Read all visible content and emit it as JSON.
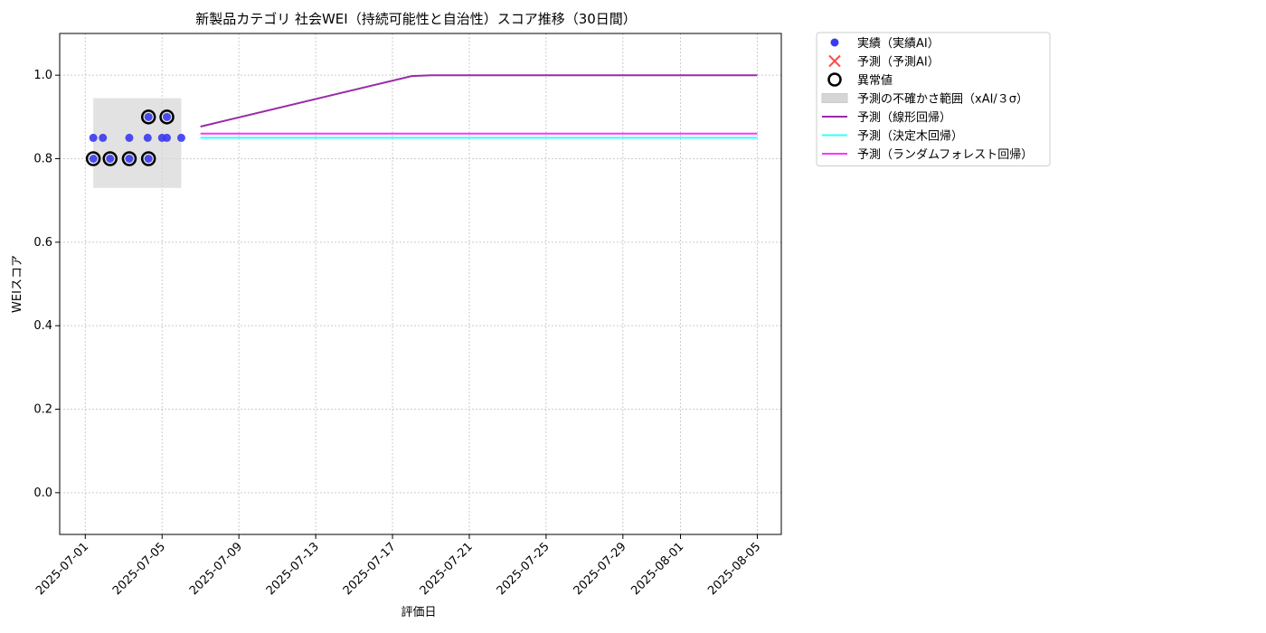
{
  "chart_data": {
    "type": "line",
    "title": "新製品カテゴリ 社会WEI（持続可能性と自治性）スコア推移（30日間）",
    "xlabel": "評価日",
    "ylabel": "WEIスコア",
    "xlim": [
      "2025-06-29T16:00",
      "2025-08-06T06:00"
    ],
    "ylim": [
      -0.1,
      1.1
    ],
    "x_ticks": [
      "2025-07-01",
      "2025-07-05",
      "2025-07-09",
      "2025-07-13",
      "2025-07-17",
      "2025-07-21",
      "2025-07-25",
      "2025-07-29",
      "2025-08-01",
      "2025-08-05"
    ],
    "x_tick_label_rotation": 45,
    "y_ticks": [
      0.0,
      0.2,
      0.4,
      0.6,
      0.8,
      1.0
    ],
    "y_tick_labels": [
      "0.0",
      "0.2",
      "0.4",
      "0.6",
      "0.8",
      "1.0"
    ],
    "grid": true,
    "legend_position": "outside-top-right",
    "legend": [
      {
        "key": "actual",
        "label": "実績（実績AI）",
        "marker": "dot",
        "color": "#3a3af0"
      },
      {
        "key": "forecast_ai",
        "label": "予測（予測AI）",
        "marker": "x",
        "color": "#ff4a4a"
      },
      {
        "key": "anomaly",
        "label": "異常値",
        "marker": "ring",
        "color": "#000000"
      },
      {
        "key": "uncertainty",
        "label": "予測の不確かさ範囲（xAI/３σ）",
        "marker": "box",
        "color": "#d6d6d6"
      },
      {
        "key": "linear",
        "label": "予測（線形回帰）",
        "marker": "line",
        "color": "#9a2aa8"
      },
      {
        "key": "tree",
        "label": "予測（決定木回帰）",
        "marker": "line",
        "color": "#33ffff"
      },
      {
        "key": "forest",
        "label": "予測（ランダムフォレスト回帰）",
        "marker": "line",
        "color": "#ff33ff"
      }
    ],
    "series": [
      {
        "key": "actual",
        "name": "実績（実績AI）",
        "kind": "scatter",
        "color": "#3a3af0",
        "points": [
          {
            "x": "2025-07-01T10:00",
            "y": 0.85
          },
          {
            "x": "2025-07-01T10:00",
            "y": 0.8
          },
          {
            "x": "2025-07-01T22:00",
            "y": 0.85
          },
          {
            "x": "2025-07-02T07:00",
            "y": 0.8
          },
          {
            "x": "2025-07-03T07:00",
            "y": 0.85
          },
          {
            "x": "2025-07-03T07:00",
            "y": 0.8
          },
          {
            "x": "2025-07-04T06:00",
            "y": 0.85
          },
          {
            "x": "2025-07-04T07:00",
            "y": 0.9
          },
          {
            "x": "2025-07-04T07:00",
            "y": 0.8
          },
          {
            "x": "2025-07-05T00:00",
            "y": 0.85
          },
          {
            "x": "2025-07-05T06:00",
            "y": 0.85
          },
          {
            "x": "2025-07-05T06:00",
            "y": 0.9
          },
          {
            "x": "2025-07-06T00:00",
            "y": 0.85
          }
        ]
      },
      {
        "key": "anomaly",
        "name": "異常値",
        "kind": "ring",
        "color": "#000000",
        "points": [
          {
            "x": "2025-07-01T10:00",
            "y": 0.8
          },
          {
            "x": "2025-07-02T07:00",
            "y": 0.8
          },
          {
            "x": "2025-07-03T07:00",
            "y": 0.8
          },
          {
            "x": "2025-07-04T07:00",
            "y": 0.8
          },
          {
            "x": "2025-07-04T07:00",
            "y": 0.9
          },
          {
            "x": "2025-07-05T06:00",
            "y": 0.9
          }
        ]
      },
      {
        "key": "uncertainty",
        "name": "予測の不確かさ範囲（xAI/３σ）",
        "kind": "band",
        "color": "#d6d6d6",
        "x_start": "2025-07-01T10:00",
        "x_end": "2025-07-06T00:00",
        "y_low": 0.73,
        "y_high": 0.945
      },
      {
        "key": "linear",
        "name": "予測（線形回帰）",
        "kind": "line",
        "color": "#9a2aa8",
        "points": [
          {
            "x": "2025-07-07T00:00",
            "y": 0.877
          },
          {
            "x": "2025-07-18T00:00",
            "y": 0.998
          },
          {
            "x": "2025-07-19T00:00",
            "y": 1.0
          },
          {
            "x": "2025-08-05T00:00",
            "y": 1.0
          }
        ]
      },
      {
        "key": "tree",
        "name": "予測（決定木回帰）",
        "kind": "line",
        "color": "#33ffff",
        "points": [
          {
            "x": "2025-07-07T00:00",
            "y": 0.85
          },
          {
            "x": "2025-08-05T00:00",
            "y": 0.85
          }
        ]
      },
      {
        "key": "forest",
        "name": "予測（ランダムフォレスト回帰）",
        "kind": "line",
        "color": "#ff33ff",
        "points": [
          {
            "x": "2025-07-07T00:00",
            "y": 0.86
          },
          {
            "x": "2025-08-05T00:00",
            "y": 0.86
          }
        ]
      }
    ]
  }
}
